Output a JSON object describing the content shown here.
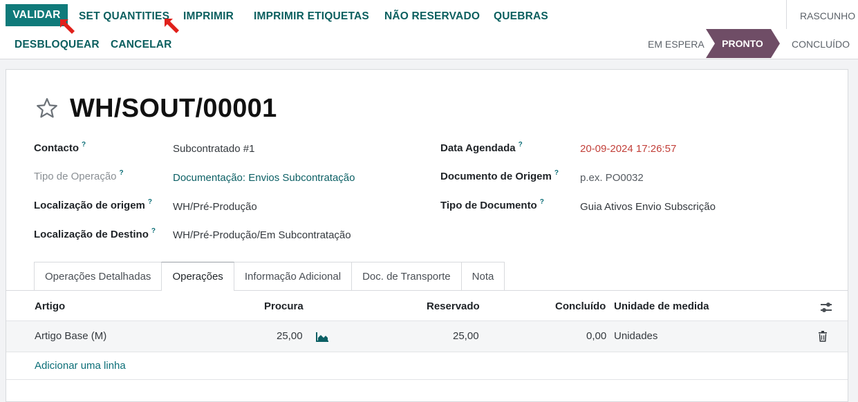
{
  "toolbar": {
    "validar": "VALIDAR",
    "set_quantities": "SET QUANTITIES",
    "imprimir": "IMPRIMIR",
    "imprimir_etiquetas": "IMPRIMIR ETIQUETAS",
    "nao_reservado": "NÃO RESERVADO",
    "quebras": "QUEBRAS",
    "desbloquear": "DESBLOQUEAR",
    "cancelar": "CANCELAR"
  },
  "status": {
    "rascunho": "RASCUNHO",
    "em_espera": "EM ESPERA",
    "pronto": "PRONTO",
    "concluido": "CONCLUÍDO",
    "active_color": "#6f4d66"
  },
  "record": {
    "title": "WH/SOUT/00001",
    "help_mark": "?"
  },
  "fields": {
    "contacto": {
      "label": "Contacto",
      "value": "Subcontratado #1"
    },
    "tipo_operacao": {
      "label": "Tipo de Operação",
      "value": "Documentação: Envios Subcontratação"
    },
    "localizacao_origem": {
      "label": "Localização de origem",
      "value": "WH/Pré-Produção"
    },
    "localizacao_destino": {
      "label": "Localização de Destino",
      "value": "WH/Pré-Produção/Em Subcontratação"
    },
    "data_agendada": {
      "label": "Data Agendada",
      "value": "20-09-2024 17:26:57"
    },
    "documento_origem": {
      "label": "Documento de Origem",
      "placeholder": "p.ex. PO0032"
    },
    "tipo_documento": {
      "label": "Tipo de Documento",
      "value": "Guia Ativos Envio Subscrição"
    }
  },
  "tabs": [
    "Operações Detalhadas",
    "Operações",
    "Informação Adicional",
    "Doc. de Transporte",
    "Nota"
  ],
  "table": {
    "columns": {
      "artigo": "Artigo",
      "procura": "Procura",
      "reservado": "Reservado",
      "concluido": "Concluído",
      "unidade": "Unidade de medida"
    },
    "rows": [
      {
        "artigo": "Artigo Base (M)",
        "procura": "25,00",
        "reservado": "25,00",
        "concluido": "0,00",
        "unidade": "Unidades"
      }
    ],
    "add_line": "Adicionar uma linha"
  },
  "colors": {
    "primary": "#0f7a7a",
    "link": "#0b5f5f",
    "date_warning": "#c2403a",
    "annotation_arrow": "#e0201b"
  }
}
